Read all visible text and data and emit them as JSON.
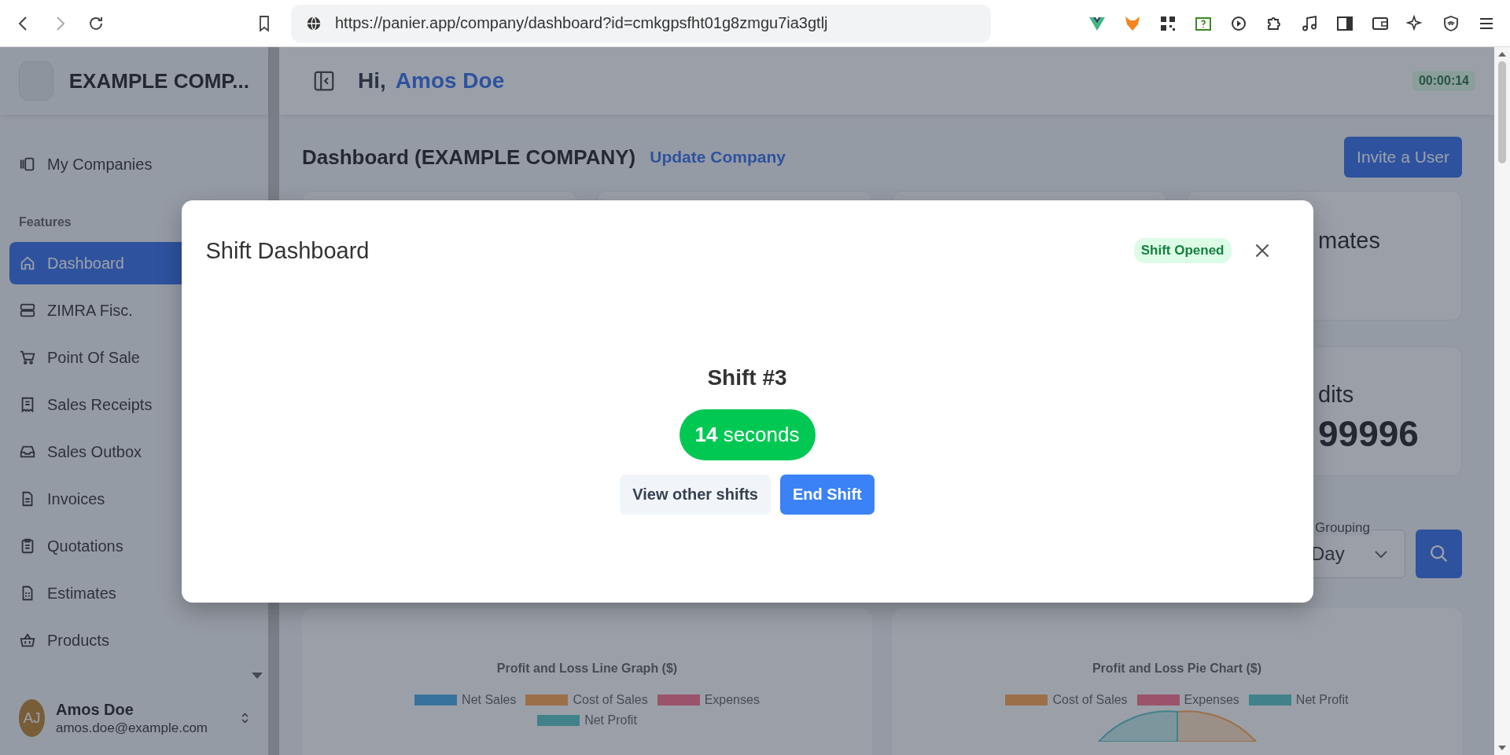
{
  "browser": {
    "url": "https://panier.app/company/dashboard?id=cmkgpsfht01g8zmgu7ia3gtlj"
  },
  "sidebar": {
    "company": "EXAMPLE COMP...",
    "top_link": "My Companies",
    "section": "Features",
    "items": [
      {
        "label": "Dashboard",
        "selected": true
      },
      {
        "label": "ZIMRA Fisc.",
        "selected": false
      },
      {
        "label": "Point Of Sale",
        "selected": false
      },
      {
        "label": "Sales Receipts",
        "selected": false
      },
      {
        "label": "Sales Outbox",
        "selected": false
      },
      {
        "label": "Invoices",
        "selected": false
      },
      {
        "label": "Quotations",
        "selected": false
      },
      {
        "label": "Estimates",
        "selected": false
      },
      {
        "label": "Products",
        "selected": false
      }
    ],
    "user": {
      "initials": "AJ",
      "name": "Amos Doe",
      "email": "amos.doe@example.com"
    }
  },
  "header": {
    "greeting": "Hi,",
    "name": "Amos Doe",
    "timer": "00:00:14"
  },
  "page": {
    "title": "Dashboard (EXAMPLE COMPANY)",
    "link": "Update Company",
    "button": "Invite a User",
    "card_row_1": {
      "label": "mates"
    },
    "card_row_2": {
      "label": "dits",
      "value": "99996"
    },
    "grouping": {
      "label": "Grouping",
      "value": "Day"
    },
    "charts": [
      {
        "title": "Profit and Loss Line Graph ($)",
        "kind": "line",
        "legend": [
          {
            "name": "Net Sales",
            "color": "#37729e"
          },
          {
            "name": "Cost of Sales",
            "color": "#9b7049"
          },
          {
            "name": "Expenses",
            "color": "#9b526b"
          },
          {
            "name": "Net Profit",
            "color": "#418189"
          }
        ]
      },
      {
        "title": "Profit and Loss Pie Chart ($)",
        "kind": "pie",
        "legend": [
          {
            "name": "Cost of Sales",
            "color": "#9b7049"
          },
          {
            "name": "Expenses",
            "color": "#9b526b"
          },
          {
            "name": "Net Profit",
            "color": "#418189"
          }
        ]
      }
    ]
  },
  "modal": {
    "title": "Shift Dashboard",
    "status": "Shift Opened",
    "shift": "Shift #3",
    "duration": "**14** seconds",
    "buttons": [
      {
        "label": "View other shifts",
        "kind": "secondary"
      },
      {
        "label": "End Shift",
        "kind": "primary"
      }
    ]
  }
}
